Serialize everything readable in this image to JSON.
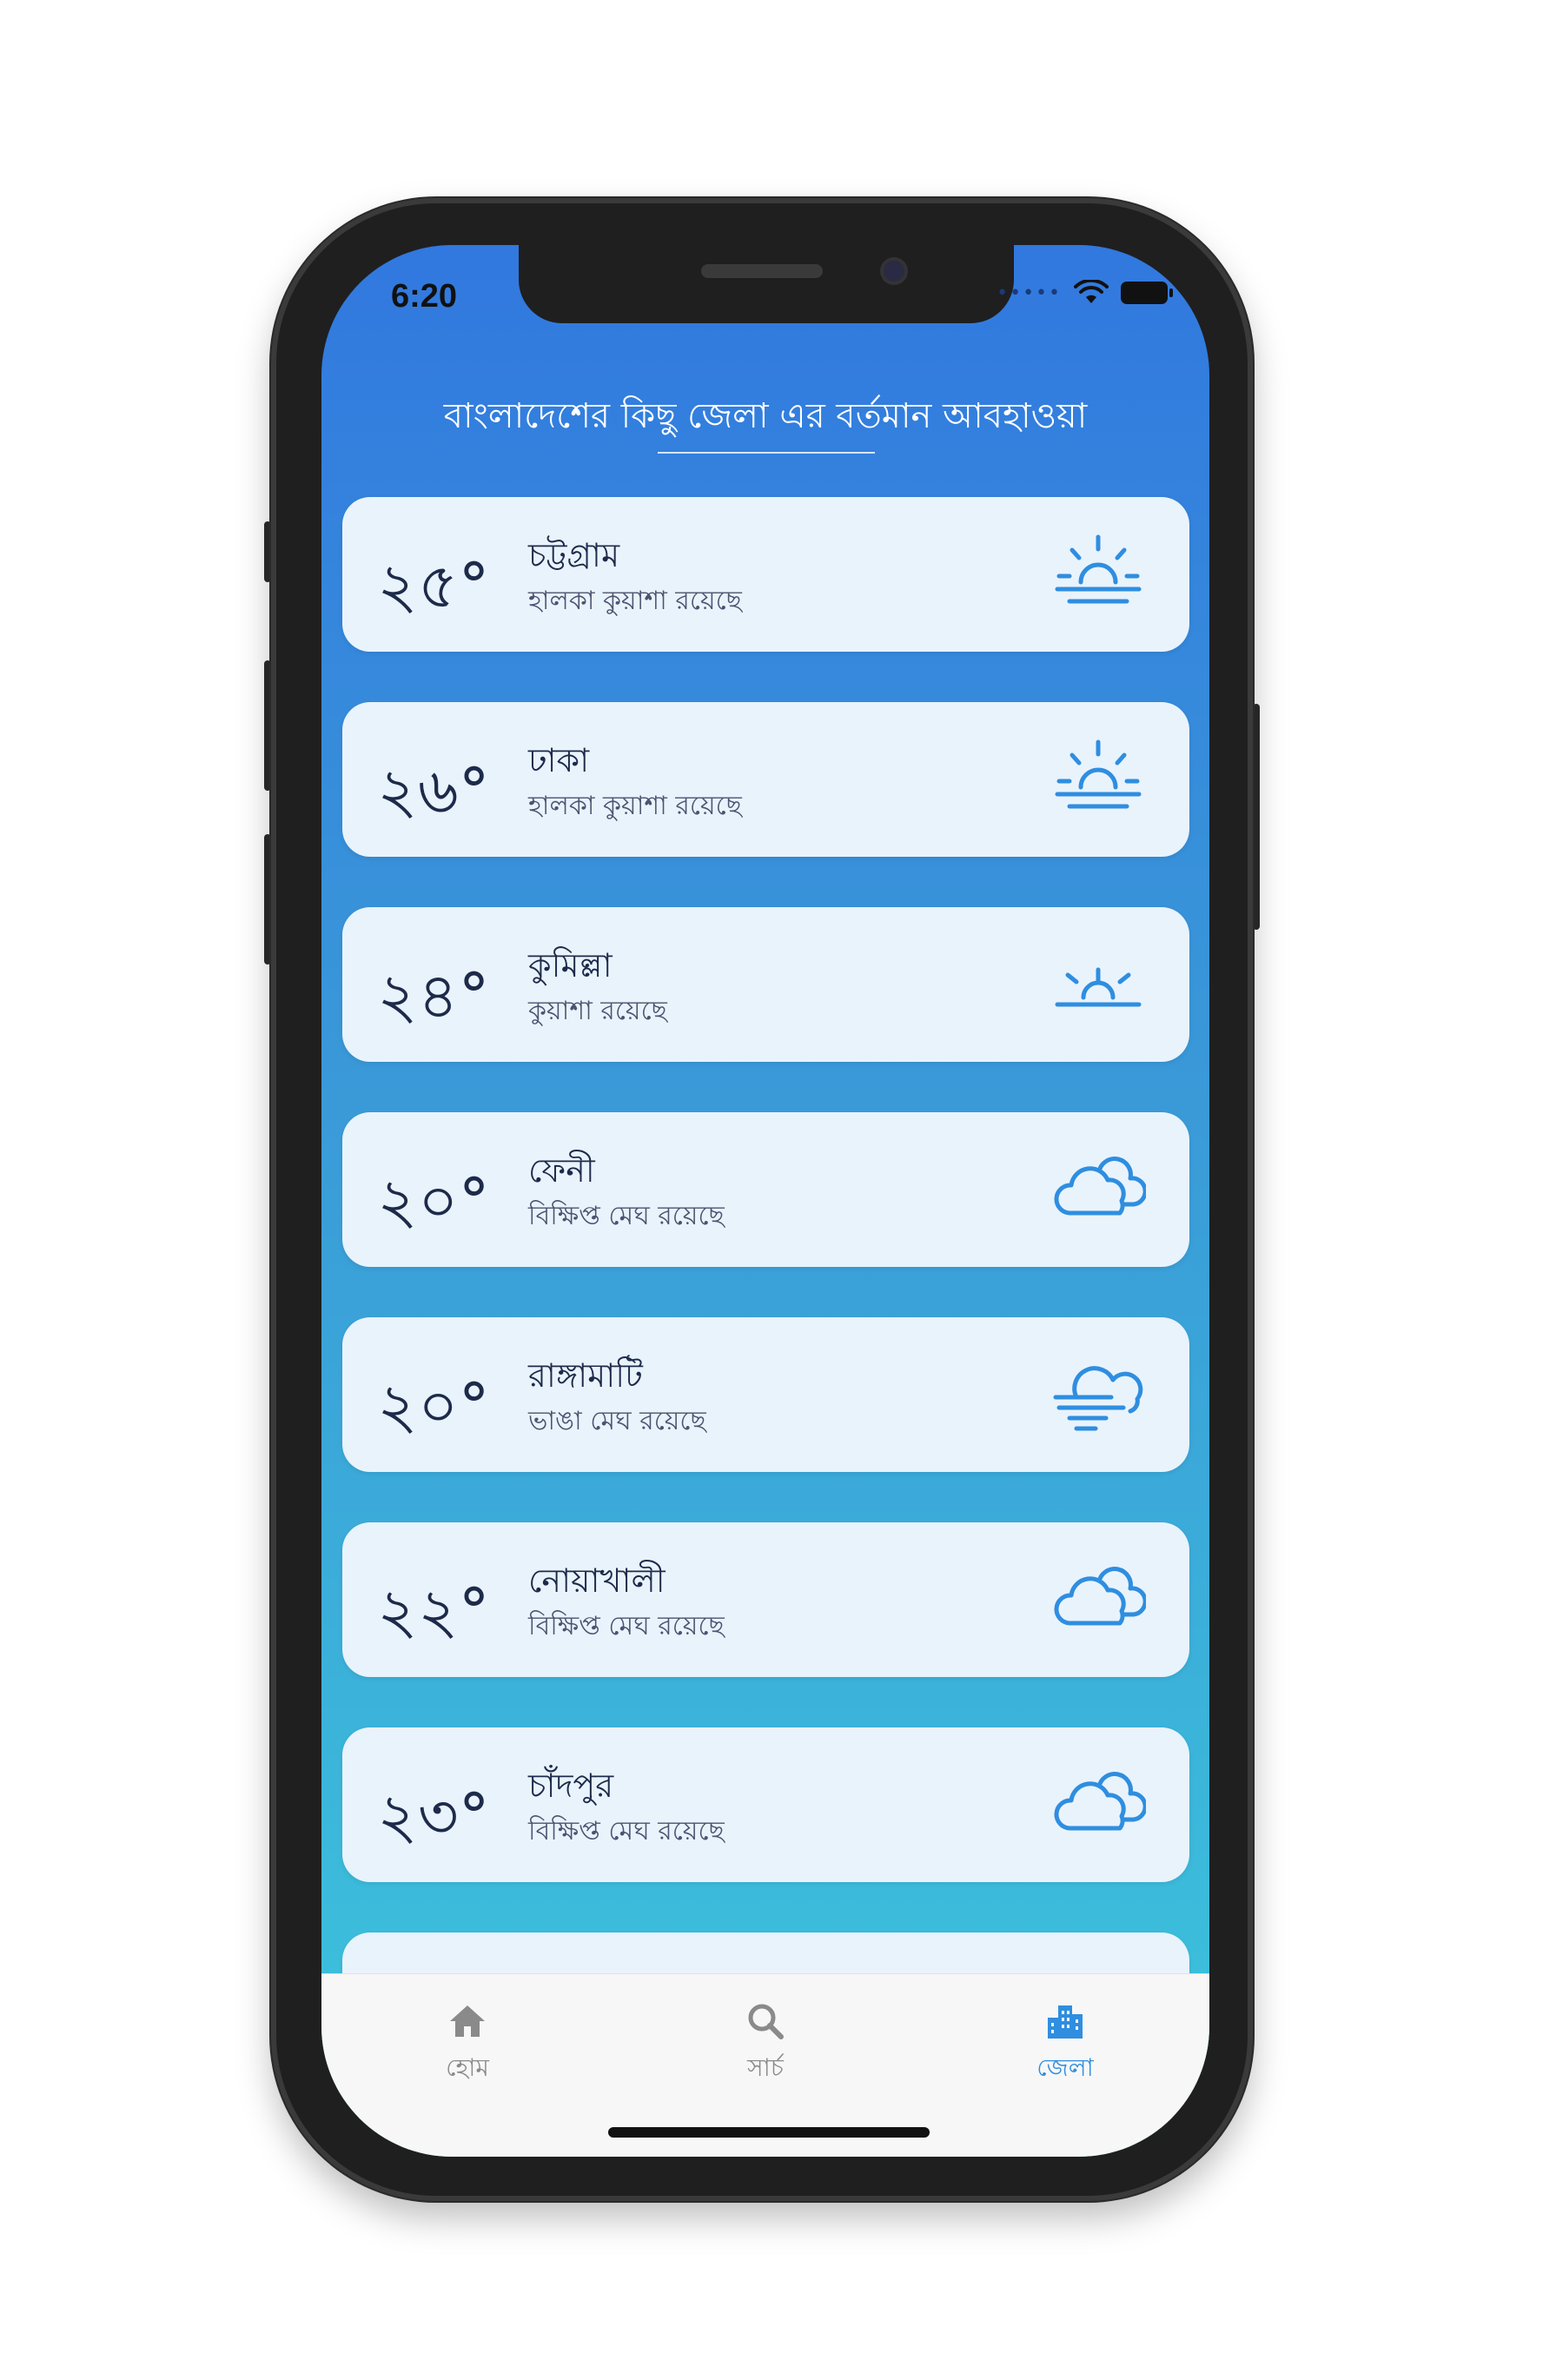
{
  "status_bar": {
    "time": "6:20",
    "dots": "•••••"
  },
  "header": {
    "title": "বাংলাদেশের কিছু জেলা এর বর্তমান আবহাওয়া"
  },
  "districts": [
    {
      "temp": "২৫°",
      "name": "চট্টগ্রাম",
      "condition": "হালকা কুয়াশা রয়েছে",
      "icon": "sunrise-icon"
    },
    {
      "temp": "২৬°",
      "name": "ঢাকা",
      "condition": "হালকা কুয়াশা রয়েছে",
      "icon": "sunrise-icon"
    },
    {
      "temp": "২৪°",
      "name": "কুমিল্লা",
      "condition": "কুয়াশা রয়েছে",
      "icon": "sunset-icon"
    },
    {
      "temp": "২০°",
      "name": "ফেনী",
      "condition": "বিক্ষিপ্ত মেঘ রয়েছে",
      "icon": "cloud-icon"
    },
    {
      "temp": "২০°",
      "name": "রাঙ্গামাটি",
      "condition": "ভাঙা মেঘ রয়েছে",
      "icon": "fog-cloud-icon"
    },
    {
      "temp": "২২°",
      "name": "নোয়াখালী",
      "condition": "বিক্ষিপ্ত মেঘ রয়েছে",
      "icon": "cloud-icon"
    },
    {
      "temp": "২৩°",
      "name": "চাঁদপুর",
      "condition": "বিক্ষিপ্ত মেঘ রয়েছে",
      "icon": "cloud-icon"
    }
  ],
  "tabs": [
    {
      "label": "হোম",
      "icon": "home-icon",
      "active": false
    },
    {
      "label": "সার্চ",
      "icon": "search-icon",
      "active": false
    },
    {
      "label": "জেলা",
      "icon": "city-icon",
      "active": true
    }
  ],
  "colors": {
    "accent": "#2f8ee0",
    "inactive": "#8a8a8a",
    "card_bg": "#e9f3fc"
  }
}
